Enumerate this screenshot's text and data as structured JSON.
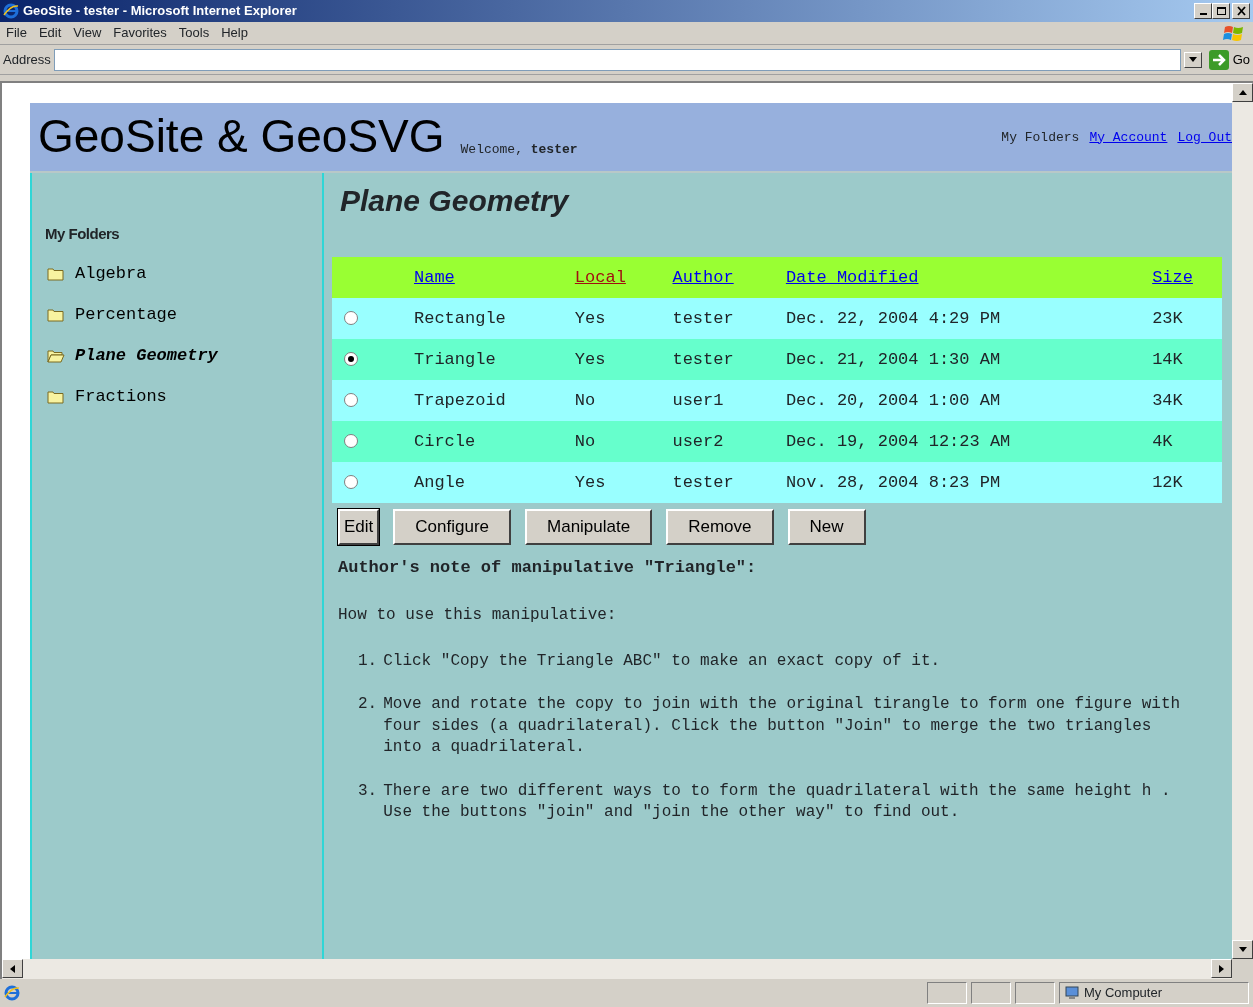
{
  "window": {
    "title": "GeoSite - tester - Microsoft Internet Explorer"
  },
  "menu_bar": [
    "File",
    "Edit",
    "View",
    "Favorites",
    "Tools",
    "Help"
  ],
  "address_bar": {
    "label": "Address",
    "go": "Go"
  },
  "header": {
    "title": "GeoSite & GeoSVG",
    "welcome": "Welcome, **tester**",
    "nav": [
      {
        "kind": "text",
        "label": "My Folders"
      },
      {
        "kind": "link",
        "label": "My Account"
      },
      {
        "kind": "link",
        "label": "Log Out"
      }
    ]
  },
  "sidebar": {
    "heading": "My Folders",
    "items": [
      {
        "label": "Algebra",
        "selected": false
      },
      {
        "label": "Percentage",
        "selected": false
      },
      {
        "label": "Plane Geometry",
        "selected": true
      },
      {
        "label": "Fractions",
        "selected": false
      }
    ]
  },
  "main": {
    "title": "Plane Geometry"
  },
  "table": {
    "columns": [
      {
        "label": "Name",
        "visited": false
      },
      {
        "label": "Local",
        "visited": true
      },
      {
        "label": "Author",
        "visited": false
      },
      {
        "label": "Date Modified",
        "visited": false
      },
      {
        "label": "Size",
        "visited": false
      }
    ],
    "rows": [
      {
        "selected": false,
        "cells": [
          "Rectangle",
          "Yes",
          "tester",
          "Dec. 22, 2004 4:29 PM",
          "23K"
        ]
      },
      {
        "selected": true,
        "cells": [
          "Triangle",
          "Yes",
          "tester",
          "Dec. 21, 2004 1:30 AM",
          "14K"
        ]
      },
      {
        "selected": false,
        "cells": [
          "Trapezoid",
          "No",
          "user1",
          "Dec. 20, 2004 1:00 AM",
          "34K"
        ]
      },
      {
        "selected": false,
        "cells": [
          "Circle",
          "No",
          "user2",
          "Dec. 19, 2004 12:23 AM",
          "4K"
        ]
      },
      {
        "selected": false,
        "cells": [
          "Angle",
          "Yes",
          "tester",
          "Nov. 28, 2004 8:23 PM",
          "12K"
        ]
      }
    ]
  },
  "buttons": [
    {
      "label": "Edit",
      "focused": true
    },
    {
      "label": "Configure",
      "focused": false
    },
    {
      "label": "Manipulate",
      "focused": false
    },
    {
      "label": "Remove",
      "focused": false
    },
    {
      "label": "New",
      "focused": false
    }
  ],
  "note": {
    "heading": "Author's note of manipulative \"Triangle\":",
    "intro": "How to use this manipulative:",
    "steps": [
      {
        "number": "1.",
        "text": "Click \"Copy the Triangle ABC\" to make an exact copy of it."
      },
      {
        "number": "2.",
        "text": "Move and rotate the copy to join with the original tirangle to form one figure with four sides (a quadrilateral). Click the button \"Join\" to merge the two triangles into a quadrilateral."
      },
      {
        "number": "3.",
        "text": "There are two different ways to to form the quadrilateral with the same height h . Use the buttons \"join\" and \"join the other way\" to find out."
      }
    ]
  },
  "status_bar": {
    "zone": "My Computer"
  }
}
